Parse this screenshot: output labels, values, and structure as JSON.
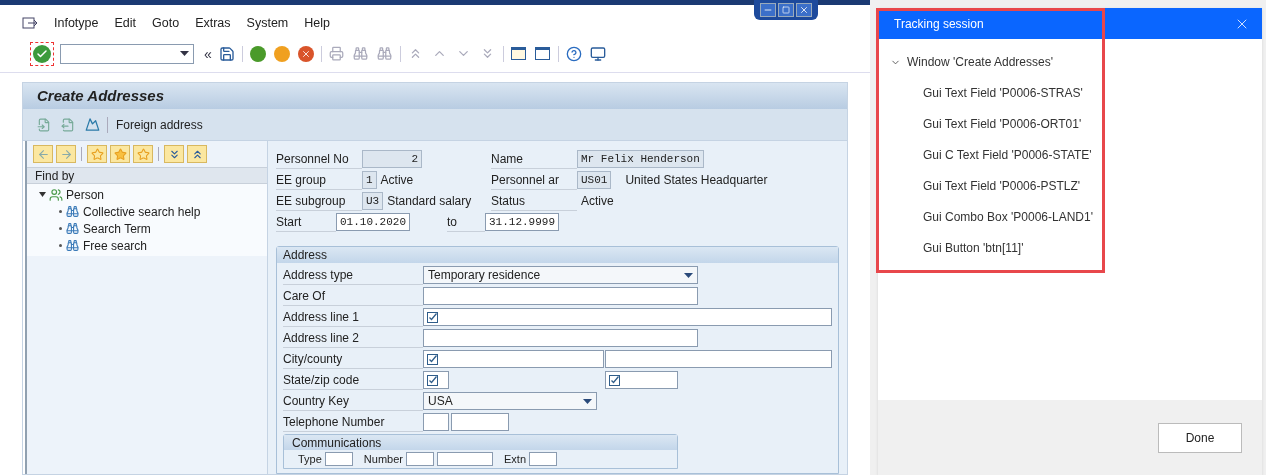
{
  "menu": [
    {
      "label": "Infotype"
    },
    {
      "label": "Edit"
    },
    {
      "label": "Goto"
    },
    {
      "label": "Extras"
    },
    {
      "label": "System"
    },
    {
      "label": "Help"
    }
  ],
  "toolbar": {
    "collapse_glyph": "«"
  },
  "screen_title": "Create Addresses",
  "app_toolbar": {
    "button": "Foreign address"
  },
  "find_panel": {
    "header": "Find by",
    "tree": [
      {
        "label": "Person",
        "expanded": true,
        "children": [
          {
            "label": "Collective search help"
          },
          {
            "label": "Search Term"
          },
          {
            "label": "Free search"
          }
        ]
      }
    ]
  },
  "header_rows": [
    [
      {
        "label": "Personnel No",
        "value": "2",
        "kind": "display"
      },
      {
        "label": "Name",
        "value": "Mr Felix Henderson",
        "kind": "display"
      }
    ],
    [
      {
        "label": "EE group",
        "value": "1",
        "text": "Active",
        "kind": "display"
      },
      {
        "label": "Personnel ar",
        "value": "US01",
        "text": "United States Headquarter",
        "kind": "display"
      }
    ],
    [
      {
        "label": "EE subgroup",
        "value": "U3",
        "text": "Standard salary",
        "kind": "display"
      },
      {
        "label": "Status",
        "text": "Active",
        "kind": "text"
      }
    ],
    [
      {
        "label": "Start",
        "value": "01.10.2020",
        "kind": "input"
      },
      {
        "label": "to",
        "value": "31.12.9999",
        "kind": "input"
      }
    ]
  ],
  "address": {
    "title": "Address",
    "rows": [
      {
        "label": "Address type",
        "inputs": [
          {
            "kind": "dropdown",
            "value": "Temporary residence"
          }
        ]
      },
      {
        "label": "Care Of",
        "inputs": [
          {
            "kind": "text",
            "required": false
          }
        ]
      },
      {
        "label": "Address line 1",
        "inputs": [
          {
            "kind": "text",
            "required": true
          }
        ]
      },
      {
        "label": "Address line 2",
        "inputs": [
          {
            "kind": "text",
            "required": false
          }
        ]
      },
      {
        "label": "City/county",
        "inputs": [
          {
            "kind": "text",
            "required": true
          },
          {
            "kind": "text",
            "required": false
          }
        ]
      },
      {
        "label": "State/zip code",
        "inputs": [
          {
            "kind": "text",
            "required": true
          },
          {
            "kind": "text",
            "required": true
          }
        ]
      },
      {
        "label": "Country Key",
        "inputs": [
          {
            "kind": "dropdown",
            "value": "USA"
          }
        ]
      },
      {
        "label": "Telephone Number",
        "inputs": [
          {
            "kind": "text",
            "required": false
          },
          {
            "kind": "text",
            "required": false
          }
        ]
      }
    ],
    "communications": {
      "title": "Communications",
      "fields": [
        {
          "label": "Type",
          "inputs": [
            {
              "kind": "text"
            }
          ]
        },
        {
          "label": "Number",
          "inputs": [
            {
              "kind": "text"
            },
            {
              "kind": "text"
            }
          ]
        },
        {
          "label": "Extn",
          "inputs": [
            {
              "kind": "text"
            }
          ]
        }
      ]
    }
  },
  "tracking": {
    "title": "Tracking session",
    "tree": [
      {
        "label": "Window 'Create Addresses'",
        "expanded": true,
        "children": [
          {
            "label": "Gui Text Field 'P0006-STRAS'"
          },
          {
            "label": "Gui Text Field 'P0006-ORT01'"
          },
          {
            "label": "Gui C Text Field 'P0006-STATE'"
          },
          {
            "label": "Gui Text Field 'P0006-PSTLZ'"
          },
          {
            "label": "Gui Combo Box 'P0006-LAND1'"
          },
          {
            "label": "Gui Button 'btn[11]'"
          }
        ]
      }
    ],
    "button": "Done"
  }
}
